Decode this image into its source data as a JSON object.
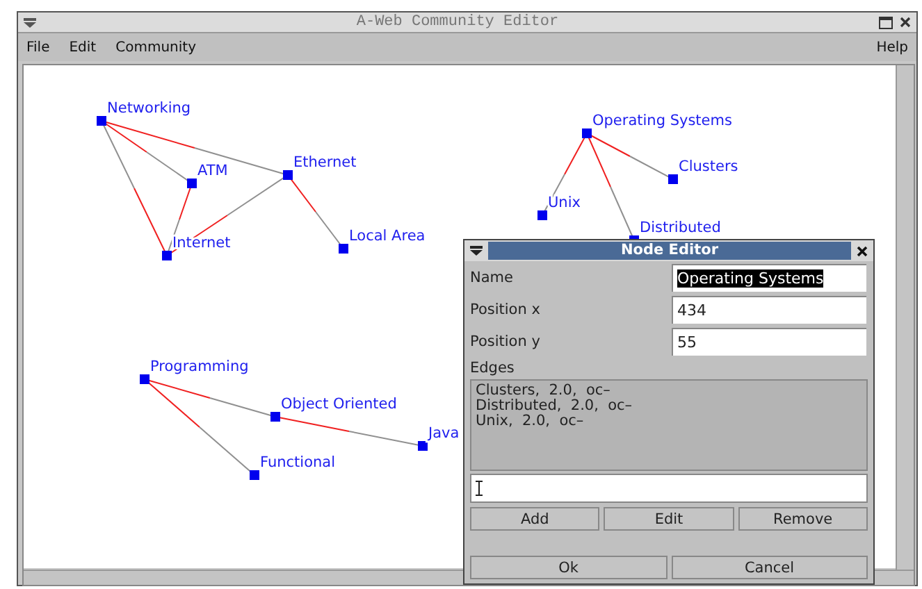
{
  "window": {
    "title": "A-Web Community Editor"
  },
  "menu": [
    {
      "label": "File"
    },
    {
      "label": "Edit"
    },
    {
      "label": "Community"
    },
    {
      "label": "Help"
    }
  ],
  "graph": {
    "nodes": [
      {
        "label": "Networking"
      },
      {
        "label": "ATM"
      },
      {
        "label": "Ethernet"
      },
      {
        "label": "Internet"
      },
      {
        "label": "Local Area"
      },
      {
        "label": "Operating Systems"
      },
      {
        "label": "Clusters"
      },
      {
        "label": "Unix"
      },
      {
        "label": "Distributed"
      },
      {
        "label": "Programming"
      },
      {
        "label": "Object Oriented"
      },
      {
        "label": "Functional"
      },
      {
        "label": "Java"
      }
    ]
  },
  "dialog": {
    "title": "Node Editor",
    "fields": [
      {
        "label": "Name",
        "value": "Operating Systems",
        "selected": true
      },
      {
        "label": "Position x",
        "value": "434",
        "selected": false
      },
      {
        "label": "Position y",
        "value": "55",
        "selected": false
      }
    ],
    "edges_label": "Edges",
    "edges": [
      "Clusters,  2.0,  oc–",
      "Distributed,  2.0,  oc–",
      "Unix,  2.0,  oc–"
    ],
    "edge_buttons": [
      "Add",
      "Edit",
      "Remove"
    ],
    "buttons": [
      "Ok",
      "Cancel"
    ]
  }
}
